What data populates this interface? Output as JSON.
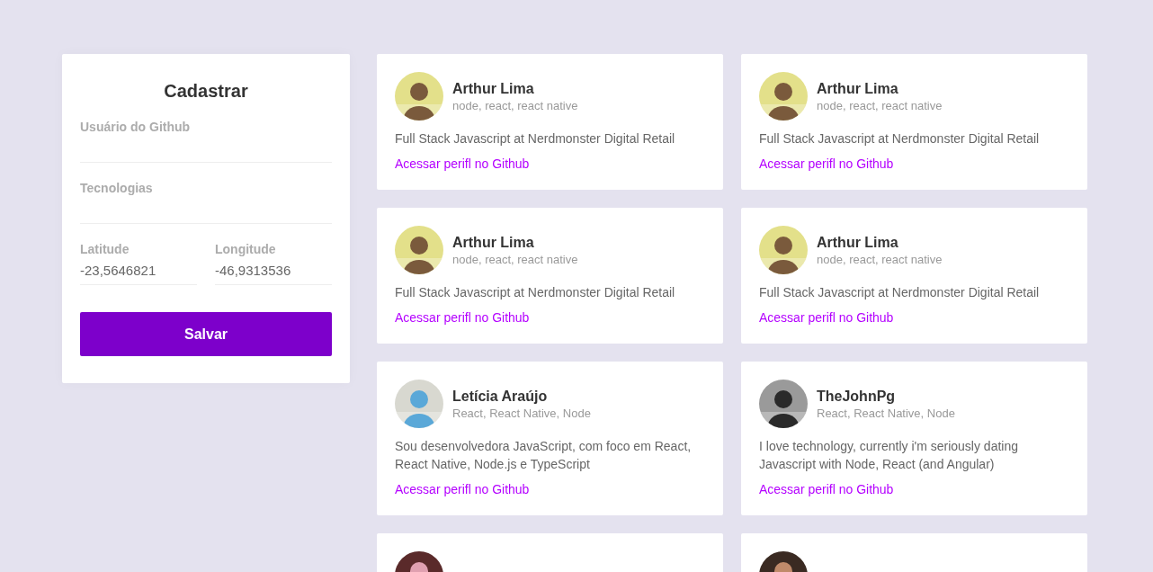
{
  "form": {
    "title": "Cadastrar",
    "fields": [
      {
        "label": "Usuário do Github"
      },
      {
        "label": "Tecnologias"
      }
    ],
    "coords": [
      {
        "label": "Latitude",
        "value": "-23,5646821"
      },
      {
        "label": "Longitude",
        "value": "-46,9313536"
      }
    ],
    "submit": "Salvar"
  },
  "devs": [
    {
      "name": "Arthur Lima",
      "techs": "node, react, react native",
      "bio": "Full Stack Javascript at Nerdmonster Digital Retail",
      "link": "Acessar perifl no Github",
      "avatar": {
        "kind": "picture"
      }
    },
    {
      "name": "Arthur Lima",
      "techs": "node, react, react native",
      "bio": "Full Stack Javascript at Nerdmonster Digital Retail",
      "link": "Acessar perifl no Github",
      "avatar": {
        "kind": "picture"
      }
    },
    {
      "name": "Arthur Lima",
      "techs": "node, react, react native",
      "bio": "Full Stack Javascript at Nerdmonster Digital Retail",
      "link": "Acessar perifl no Github",
      "avatar": {
        "kind": "picture"
      }
    },
    {
      "name": "Arthur Lima",
      "techs": "node, react, react native",
      "bio": "Full Stack Javascript at Nerdmonster Digital Retail",
      "link": "Acessar perifl no Github",
      "avatar": {
        "kind": "picture"
      }
    },
    {
      "name": "Letícia Araújo",
      "techs": "React, React Native, Node",
      "bio": "Sou desenvolvedora JavaScript, com foco em React, React Native, Node.js e TypeScript",
      "link": "Acessar perifl no Github",
      "avatar": {
        "kind": "picture"
      }
    },
    {
      "name": "TheJohnPg",
      "techs": "React, React Native, Node",
      "bio": "I love technology, currently i'm seriously dating Javascript with Node, React (and Angular)",
      "link": "Acessar perifl no Github",
      "avatar": {
        "kind": "picture"
      }
    },
    {
      "avatar": {
        "kind": "picture"
      }
    },
    {
      "avatar": {
        "kind": "picture"
      }
    }
  ]
}
